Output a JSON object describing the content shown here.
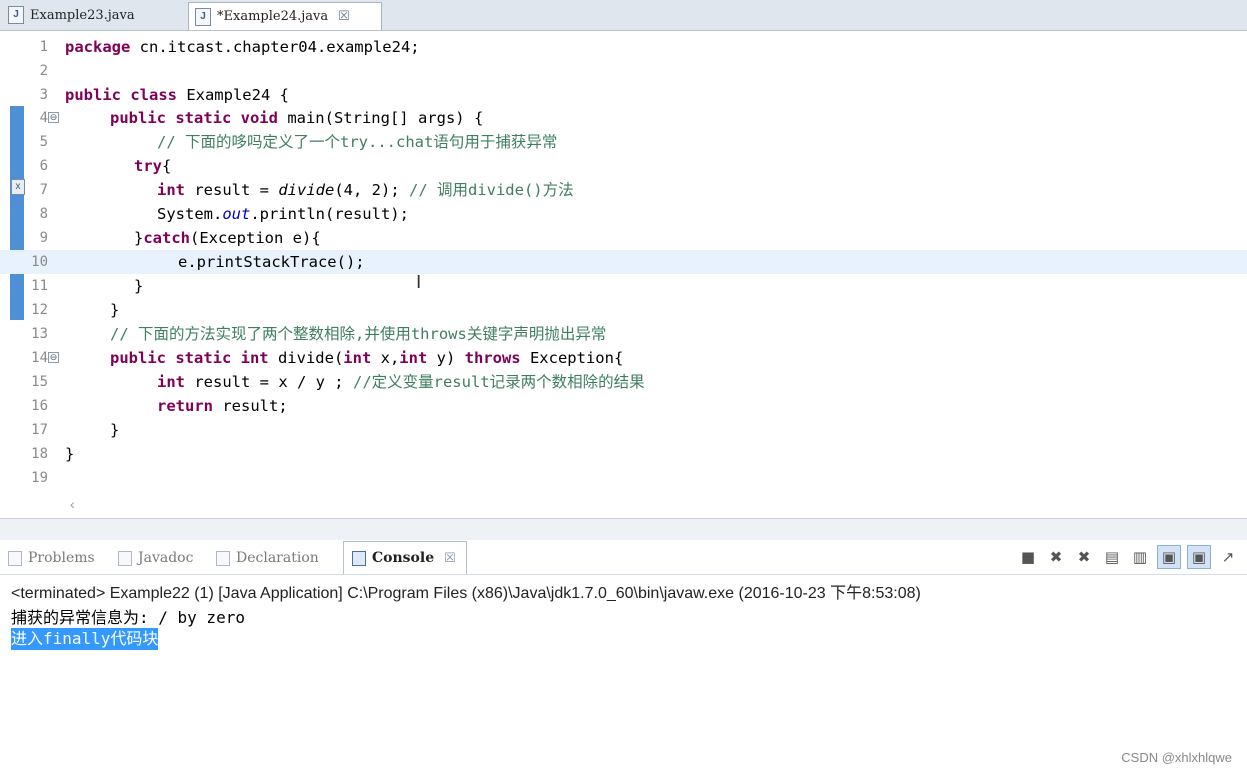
{
  "editor_tabs": [
    {
      "label": "Example23.java",
      "icon": "java-file-icon"
    },
    {
      "label": "*Example24.java",
      "icon": "java-file-icon",
      "close": "☒"
    }
  ],
  "code_lines": [
    {
      "n": "1"
    },
    {
      "n": "2"
    },
    {
      "n": "3"
    },
    {
      "n": "4"
    },
    {
      "n": "5"
    },
    {
      "n": "6"
    },
    {
      "n": "7"
    },
    {
      "n": "8"
    },
    {
      "n": "9"
    },
    {
      "n": "10"
    },
    {
      "n": "11"
    },
    {
      "n": "12"
    },
    {
      "n": "13"
    },
    {
      "n": "14"
    },
    {
      "n": "15"
    },
    {
      "n": "16"
    },
    {
      "n": "17"
    },
    {
      "n": "18"
    },
    {
      "n": "19"
    }
  ],
  "code": {
    "l1_kw": "package",
    "l1_rest": " cn.itcast.chapter04.example24;",
    "l3_kw": "public class",
    "l3_rest": " Example24 {",
    "l4_kw": "public static void",
    "l4_rest": " main(String[] args) {",
    "l5_cm": "// 下面的哆吗定义了一个try...chat语句用于捕获异常",
    "l6_kw": "try",
    "l6_rest": "{",
    "l7_kw": "int",
    "l7_a": " result = ",
    "l7_it": "divide",
    "l7_b": "(4, 2); ",
    "l7_cm": "// 调用divide()方法",
    "l8_a": "System.",
    "l8_fld": "out",
    "l8_b": ".println(result);",
    "l9_a": "}",
    "l9_kw": "catch",
    "l9_b": "(Exception e){",
    "l10": "e.printStackTrace();",
    "l11": "}",
    "l12": "}",
    "l13_cm": "// 下面的方法实现了两个整数相除,并使用throws关键字声明抛出异常",
    "l14_kw1": "public static int",
    "l14_a": " divide(",
    "l14_kw2": "int",
    "l14_b": " x,",
    "l14_kw3": "int",
    "l14_c": " y) ",
    "l14_kw4": "throws",
    "l14_d": " Exception{",
    "l15_kw": "int",
    "l15_a": " result = x / y ; ",
    "l15_cm": "//定义变量result记录两个数相除的结果",
    "l16_kw": "return",
    "l16_a": " result;",
    "l17": "}",
    "l18": "}"
  },
  "fold_marker": "⊖",
  "error_marker": "x",
  "scroll_left": "‹",
  "view_tabs": {
    "problems": "Problems",
    "javadoc": "Javadoc",
    "declaration": "Declaration",
    "console": "Console",
    "console_close": "☒"
  },
  "console_toolbar": [
    "stop-icon",
    "remove-launch-icon",
    "remove-all-icon",
    "clear-console-icon",
    "scroll-lock-icon",
    "show-on-stdout-icon",
    "show-on-stderr-icon",
    "pin-console-icon"
  ],
  "console": {
    "terminated": "<terminated> Example22 (1) [Java Application] C:\\Program Files (x86)\\Java\\jdk1.7.0_60\\bin\\javaw.exe (2016-10-23 下午8:53:08)",
    "line1": "捕获的异常信息为: / by zero",
    "line2": "进入finally代码块"
  },
  "watermark": "CSDN @xhlxhlqwe",
  "colors": {
    "keyword": "#7f0055",
    "comment": "#3f7f5f",
    "selection": "#3399ff",
    "current_line": "#e8f2fe"
  }
}
